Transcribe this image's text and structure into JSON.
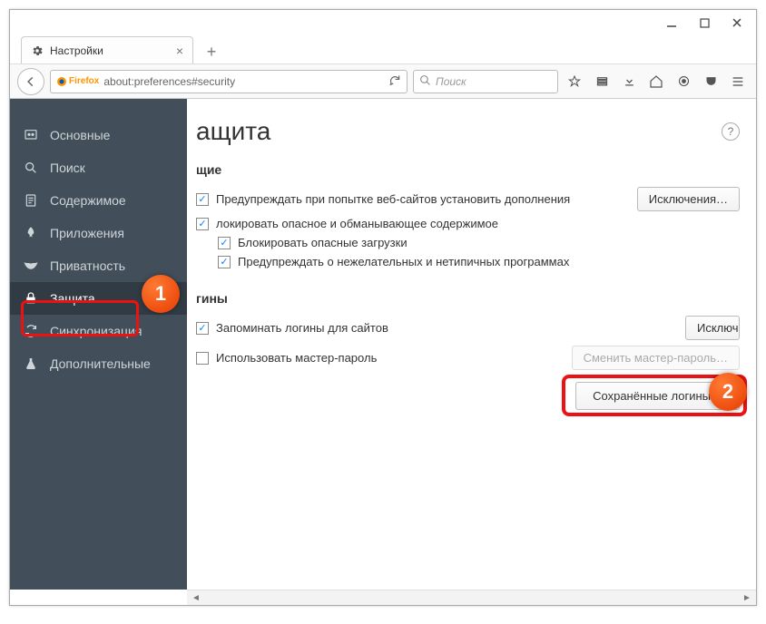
{
  "window": {
    "tab_title": "Настройки",
    "url_brand": "Firefox",
    "url": "about:preferences#security",
    "search_placeholder": "Поиск"
  },
  "sidebar": {
    "items": [
      {
        "label": "Основные"
      },
      {
        "label": "Поиск"
      },
      {
        "label": "Содержимое"
      },
      {
        "label": "Приложения"
      },
      {
        "label": "Приватность"
      },
      {
        "label": "Защита"
      },
      {
        "label": "Синхронизация"
      },
      {
        "label": "Дополнительные"
      }
    ]
  },
  "main": {
    "title_fragment": "ащита",
    "section_general_fragment": "щие",
    "warn_addons": "Предупреждать при попытке веб-сайтов установить дополнения",
    "exceptions_btn": "Исключения…",
    "block_content": "локировать опасное и обманывающее содержимое",
    "block_downloads": "Блокировать опасные загрузки",
    "warn_unwanted": "Предупреждать о нежелательных и нетипичных программах",
    "section_logins_fragment": "гины",
    "remember_logins": "Запоминать логины для сайтов",
    "exceptions_btn2_fragment": "Исключ",
    "use_master": "Использовать мастер-пароль",
    "change_master": "Сменить мастер-пароль…",
    "saved_logins": "Сохранённые логины…"
  },
  "annotations": {
    "one": "1",
    "two": "2"
  }
}
